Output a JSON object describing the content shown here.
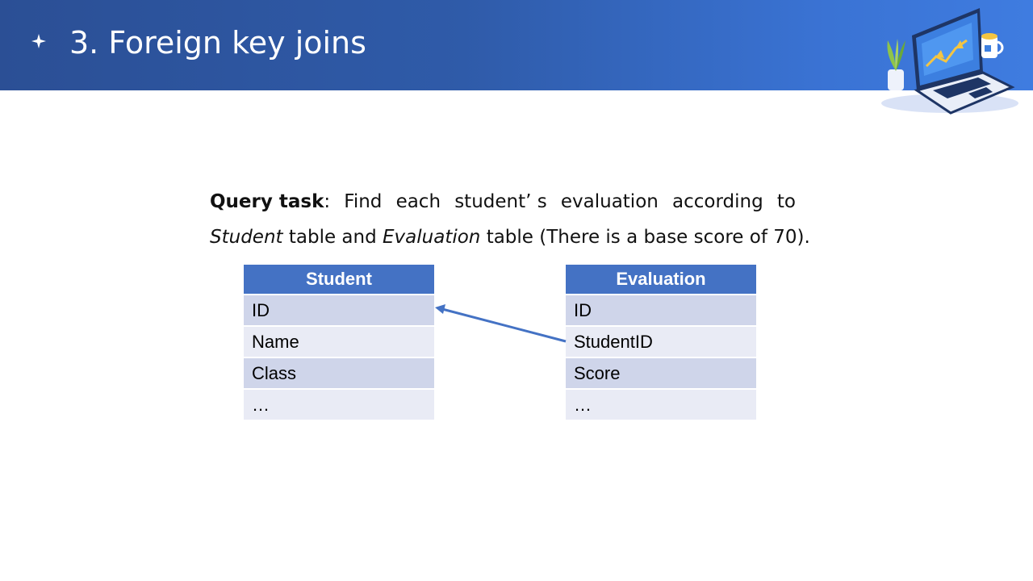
{
  "header": {
    "title": "3. Foreign key joins",
    "bullet_icon": "four-point-star-icon",
    "illustration_icon": "laptop-workspace-illustration",
    "colors": {
      "start": "#2b4f95",
      "end": "#3f7ce0"
    }
  },
  "task": {
    "label": "Query task",
    "words": [
      "Find",
      "each",
      "student’ s",
      "evaluation",
      "according",
      "to"
    ],
    "table1": "Student",
    "mid": "table and",
    "table2": "Evaluation",
    "tail": "table (There is a base score of 70)."
  },
  "tables": {
    "student": {
      "title": "Student",
      "rows": [
        "ID",
        "Name",
        "Class",
        "…"
      ]
    },
    "evaluation": {
      "title": "Evaluation",
      "rows": [
        "ID",
        "StudentID",
        "Score",
        "…"
      ]
    }
  },
  "relation": {
    "from": "Evaluation.StudentID",
    "to": "Student.ID",
    "color": "#4472c4"
  },
  "colors": {
    "table_header": "#4472c4",
    "row_dark": "#cfd5ea",
    "row_light": "#e9ebf5"
  }
}
